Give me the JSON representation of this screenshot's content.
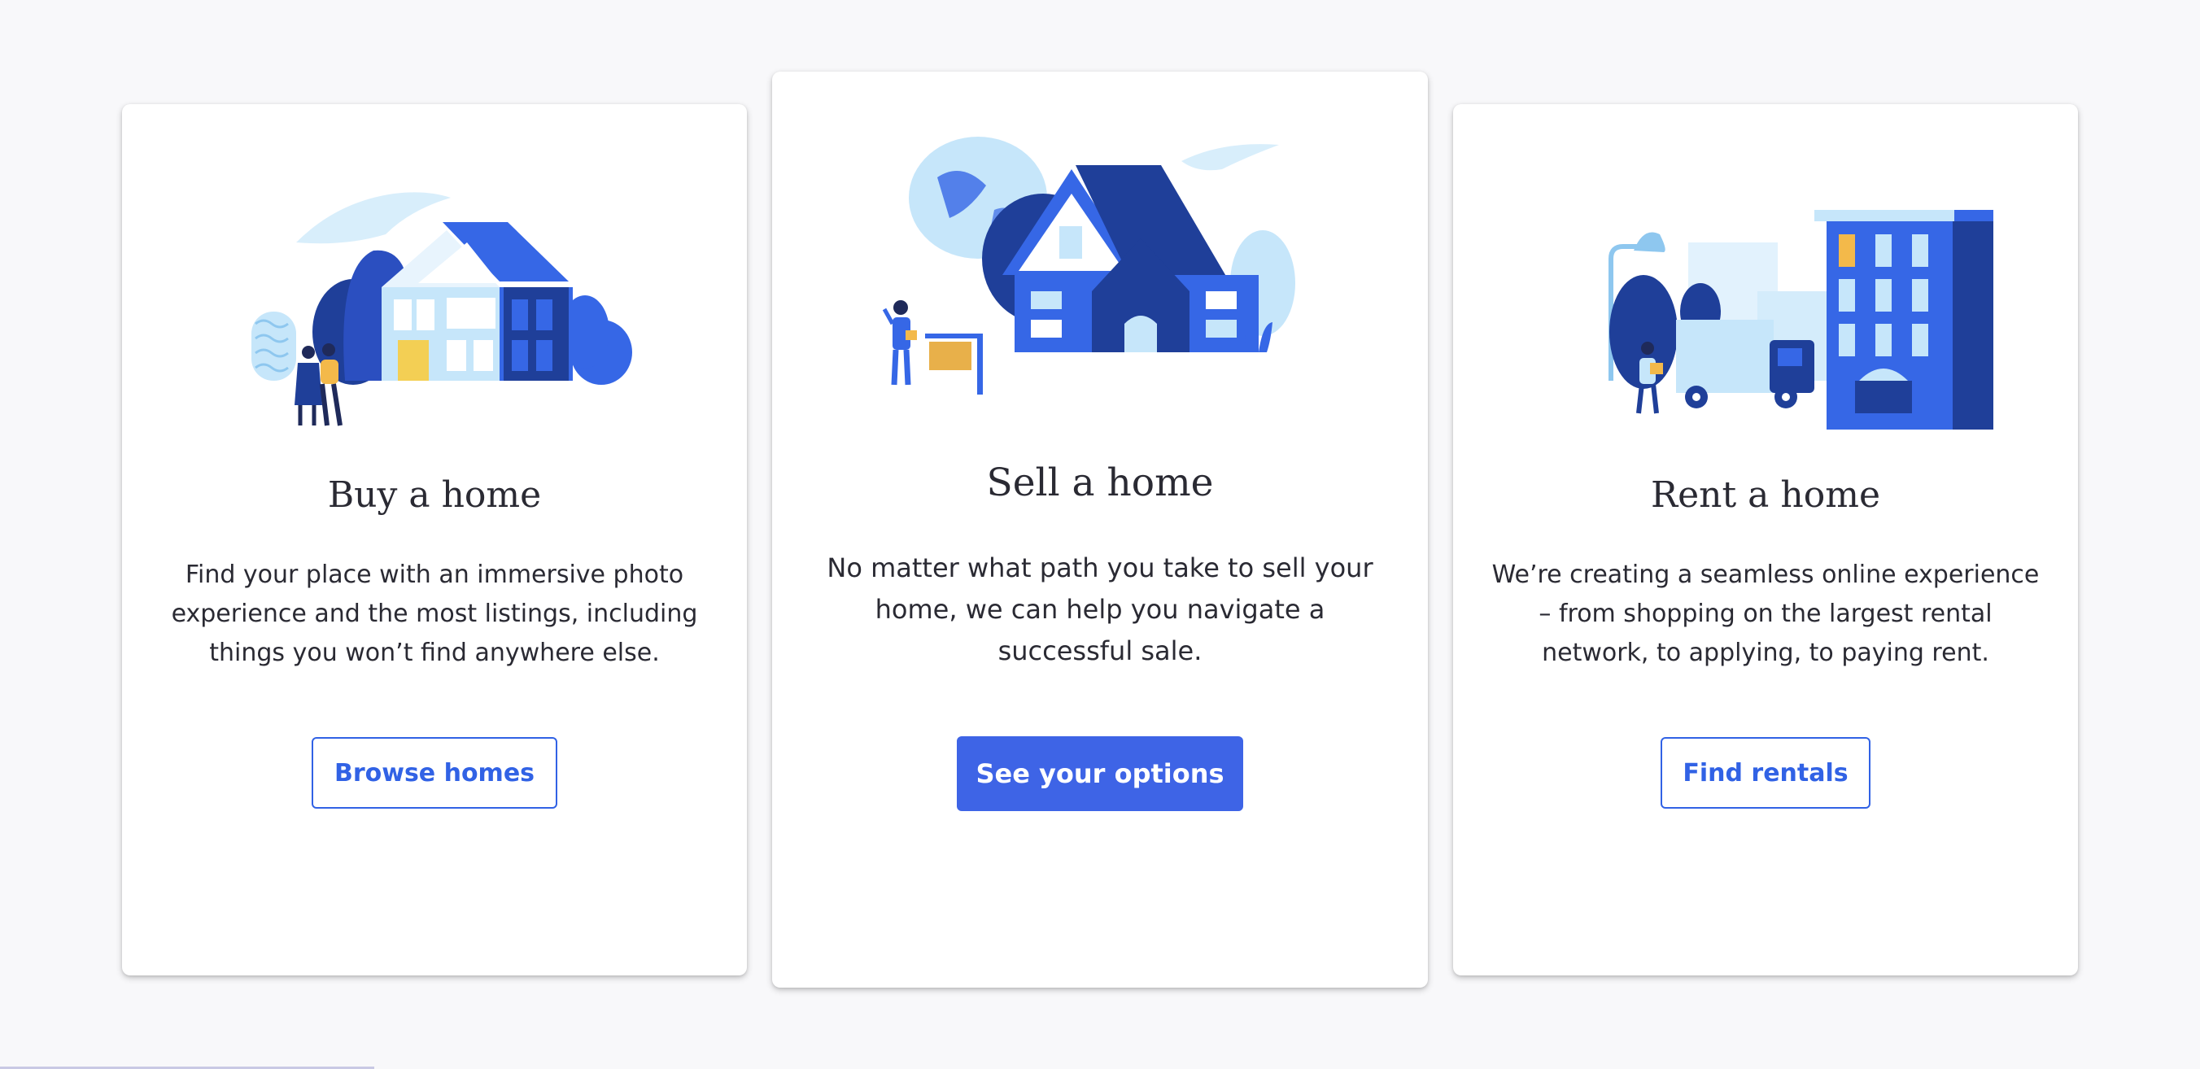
{
  "cards": [
    {
      "title": "Buy a home",
      "description": "Find your place with an immersive photo experience and the most listings, including things you won’t find anywhere else.",
      "button_label": "Browse homes",
      "button_style": "outline",
      "illustration_icon": "house-with-couple-icon"
    },
    {
      "title": "Sell a home",
      "description": "No matter what path you take to sell your home, we can help you navigate a successful sale.",
      "button_label": "See your options",
      "button_style": "solid",
      "illustration_icon": "house-with-sign-icon"
    },
    {
      "title": "Rent a home",
      "description": "We’re creating a seamless online experience – from shopping on the largest rental network, to applying, to paying rent.",
      "button_label": "Find rentals",
      "button_style": "outline",
      "illustration_icon": "apartment-building-with-truck-icon"
    }
  ],
  "colors": {
    "accent": "#3e64e6",
    "outline_text": "#3162e5",
    "dark_blue": "#1f3f99",
    "mid_blue": "#3667e6",
    "light_blue": "#c6e6fa",
    "yellow": "#f3cf54",
    "background": "#f8f8fa",
    "card": "#ffffff",
    "text": "#2a2a33"
  }
}
